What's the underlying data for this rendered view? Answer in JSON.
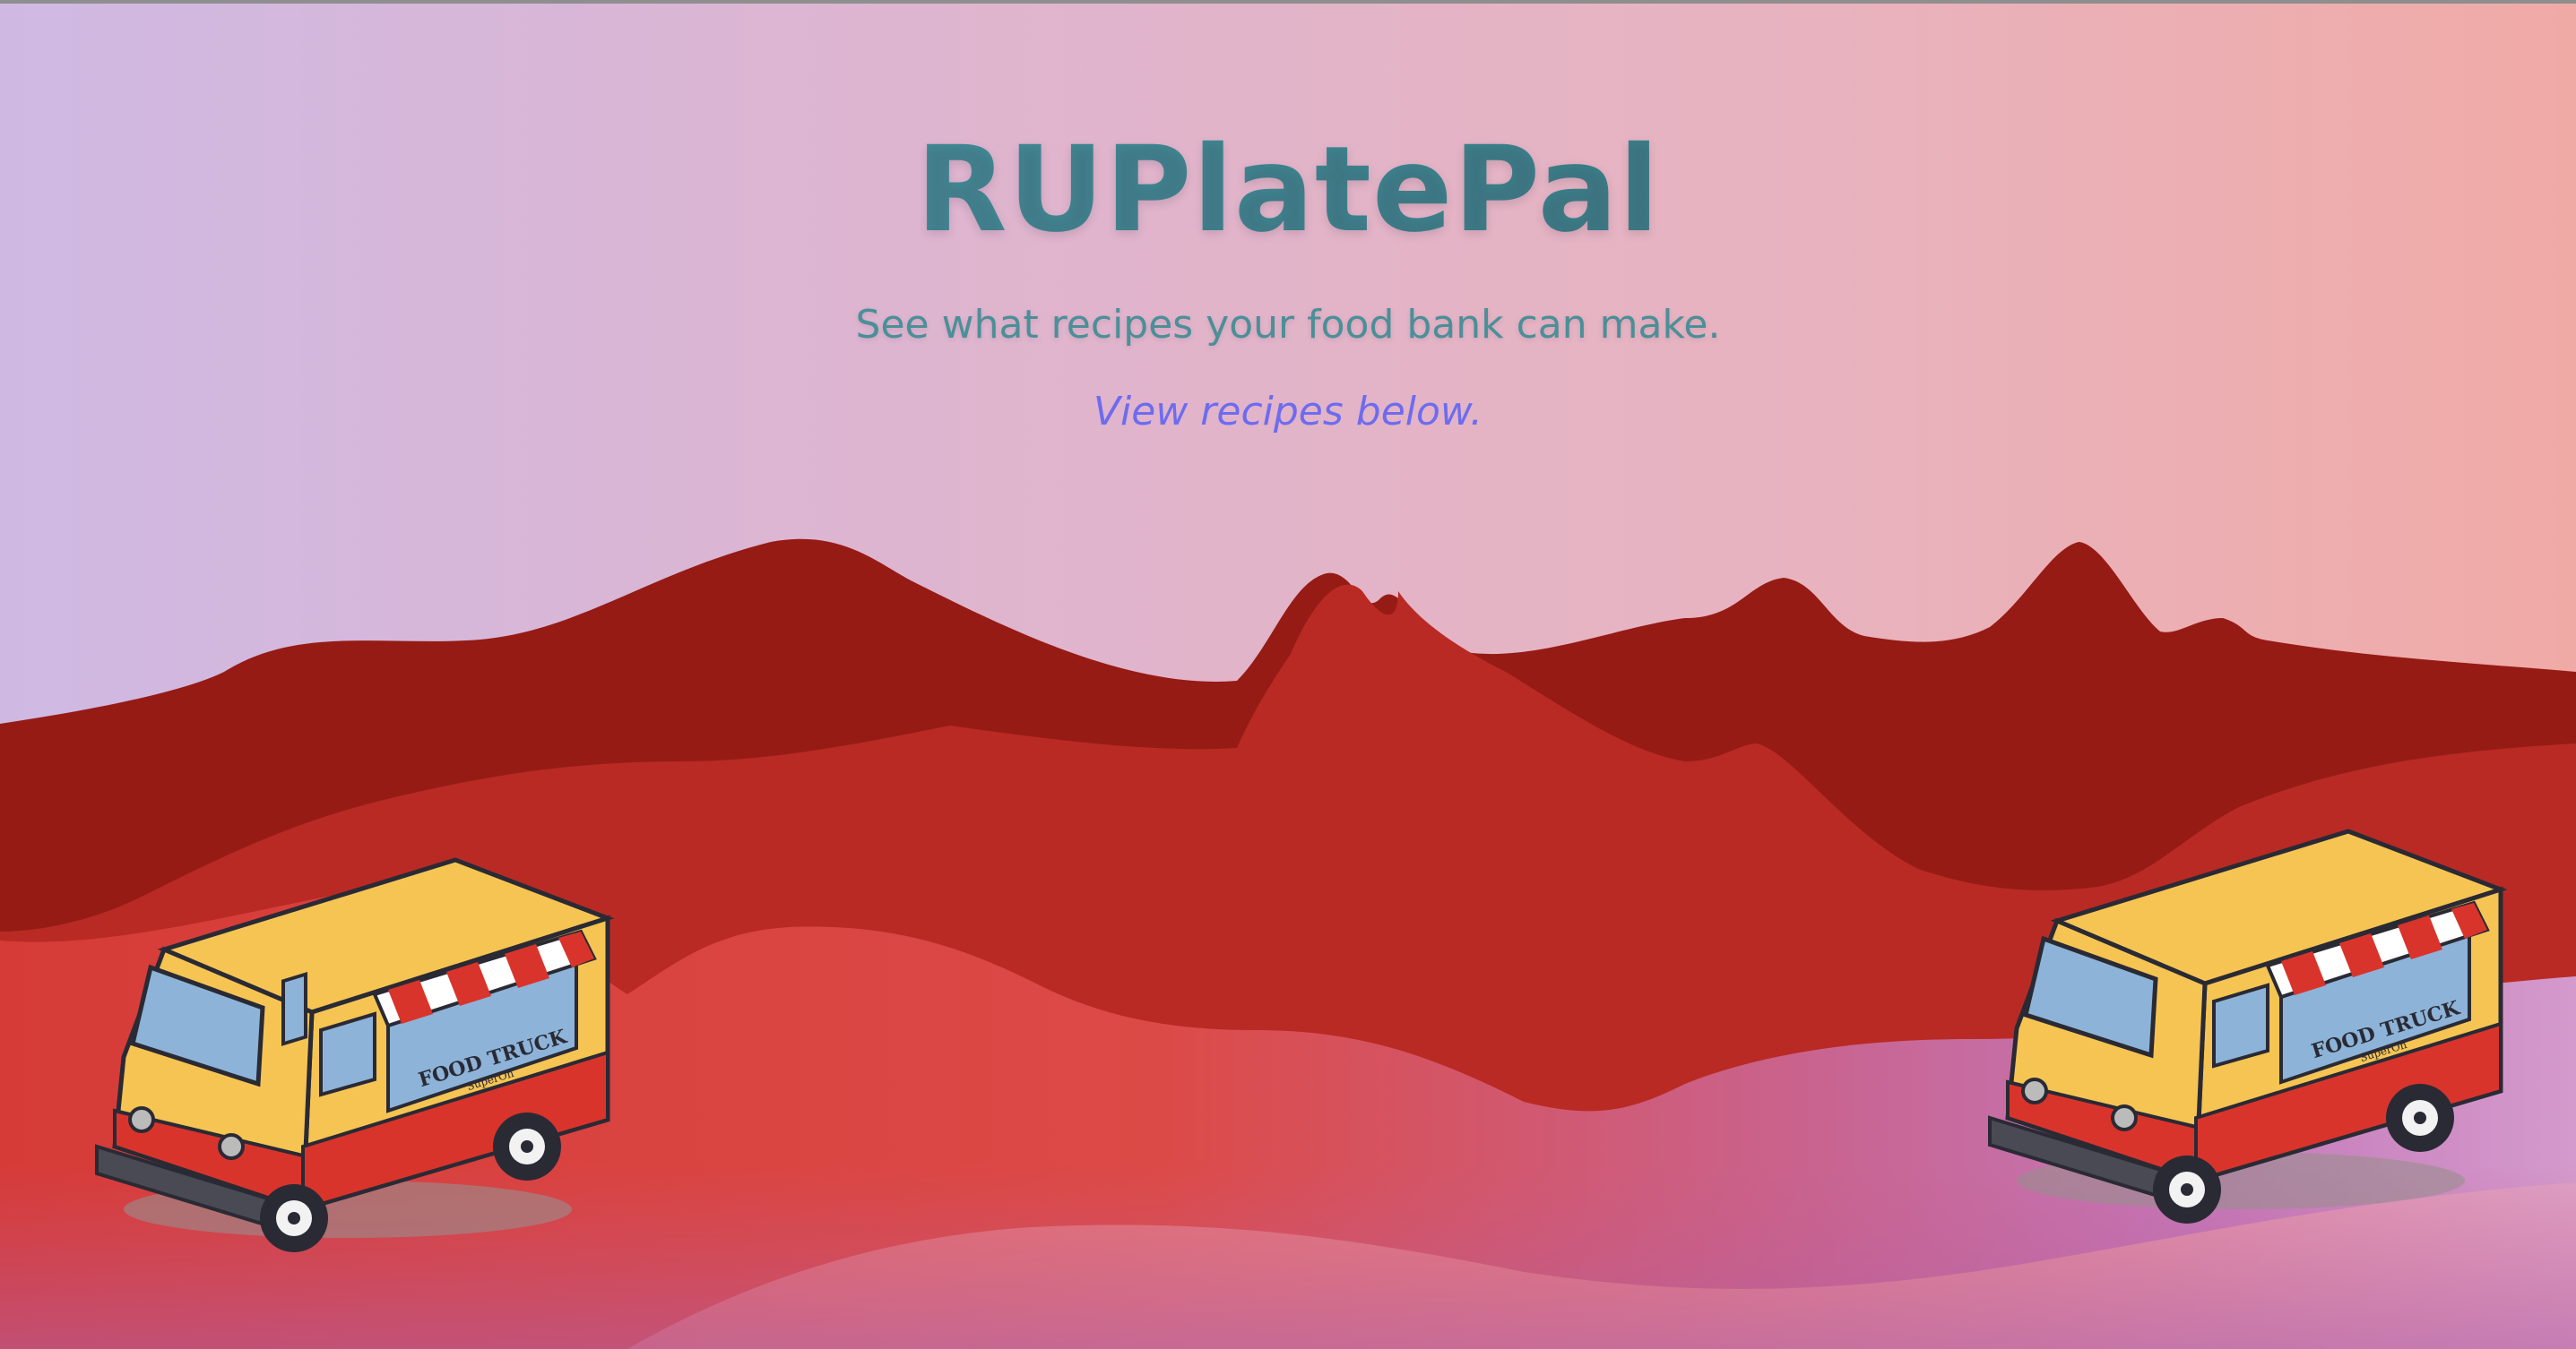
{
  "hero": {
    "title": "RUPlatePal",
    "subtitle": "See what recipes your food bank can make.",
    "cta_link": "View recipes below."
  },
  "illustrations": {
    "left_truck": {
      "sign": "FOOD TRUCK",
      "sign_sub": "SuperOn"
    },
    "right_truck": {
      "sign": "FOOD TRUCK",
      "sign_sub": "SuperOn"
    }
  },
  "colors": {
    "title": "#3c8690",
    "subtitle": "#4b8f98",
    "link": "#6d6cf0",
    "mountain_dark": "#961b15",
    "mountain_mid": "#b92a24",
    "hill_red": "#d83c37",
    "truck_body": "#f6c453",
    "truck_red": "#d9342b"
  }
}
